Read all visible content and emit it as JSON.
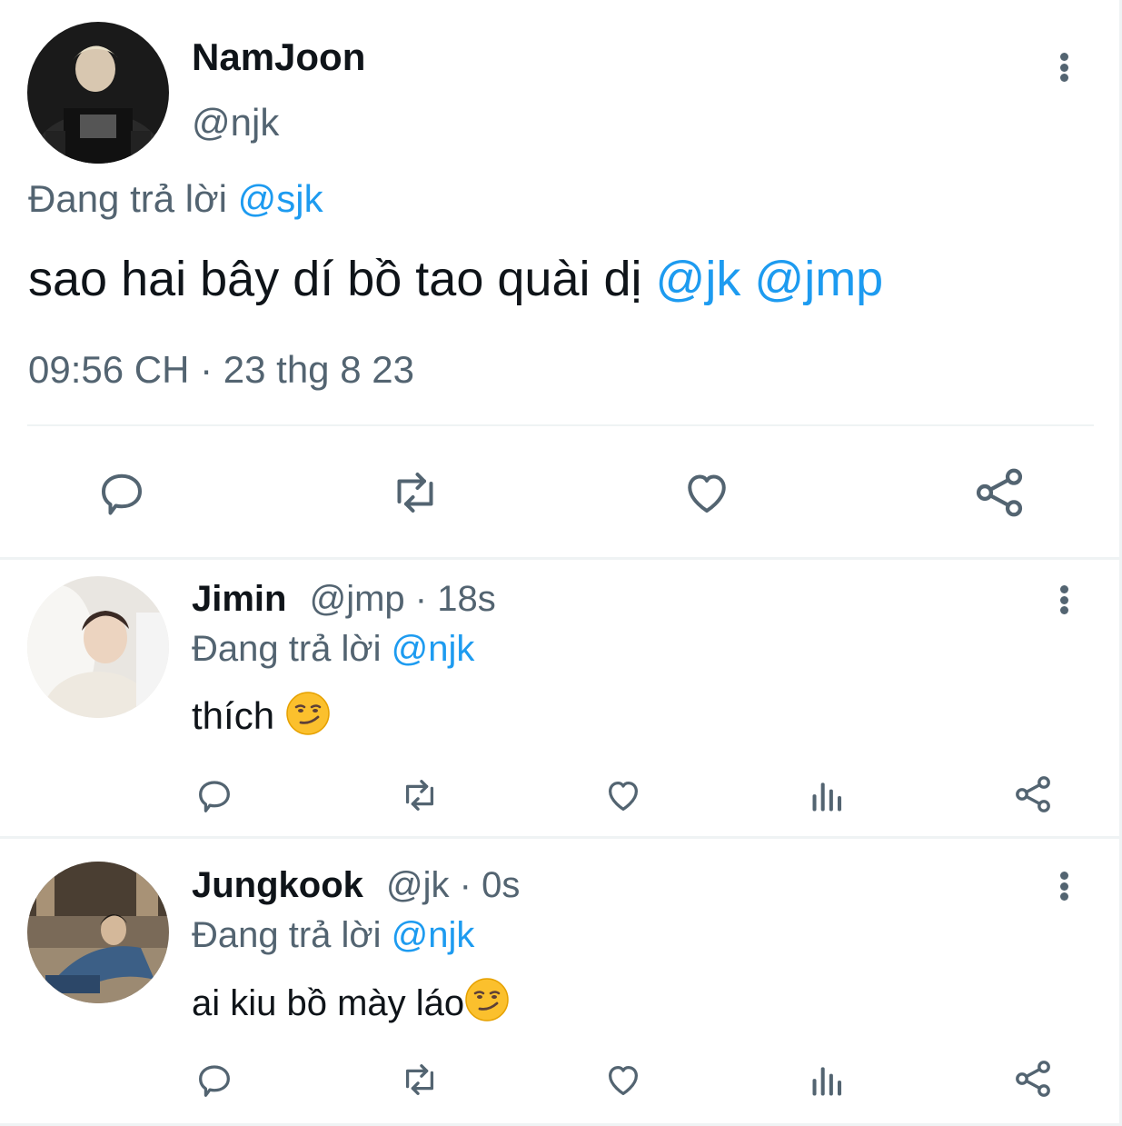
{
  "main_tweet": {
    "display_name": "NamJoon",
    "handle": "@njk",
    "reply_prefix": "Đang trả lời",
    "reply_to": "@sjk",
    "text": "sao hai bây dí bồ tao quài dị",
    "mention_1": "@jk",
    "mention_2": "@jmp",
    "timestamp": "09:56 CH · 23 thg 8 23",
    "actions": [
      "reply-icon",
      "retweet-icon",
      "like-icon",
      "share-icon"
    ]
  },
  "replies": [
    {
      "display_name": "Jimin",
      "handle": "@jmp",
      "separator": "·",
      "time": "18s",
      "reply_prefix": "Đang trả lời",
      "reply_to": "@njk",
      "text": "thích",
      "emoji": "smirking-face",
      "actions": [
        "reply-icon",
        "retweet-icon",
        "like-icon",
        "views-icon",
        "share-icon"
      ]
    },
    {
      "display_name": "Jungkook",
      "handle": "@jk",
      "separator": "·",
      "time": "0s",
      "reply_prefix": "Đang trả lời",
      "reply_to": "@njk",
      "text": "ai kiu bồ mày láo",
      "emoji": "smirking-face",
      "actions": [
        "reply-icon",
        "retweet-icon",
        "like-icon",
        "views-icon",
        "share-icon"
      ]
    }
  ],
  "colors": {
    "accent": "#1d9bf0",
    "secondary_text": "#536471",
    "primary_text": "#0f1419",
    "divider": "#eff3f4"
  }
}
